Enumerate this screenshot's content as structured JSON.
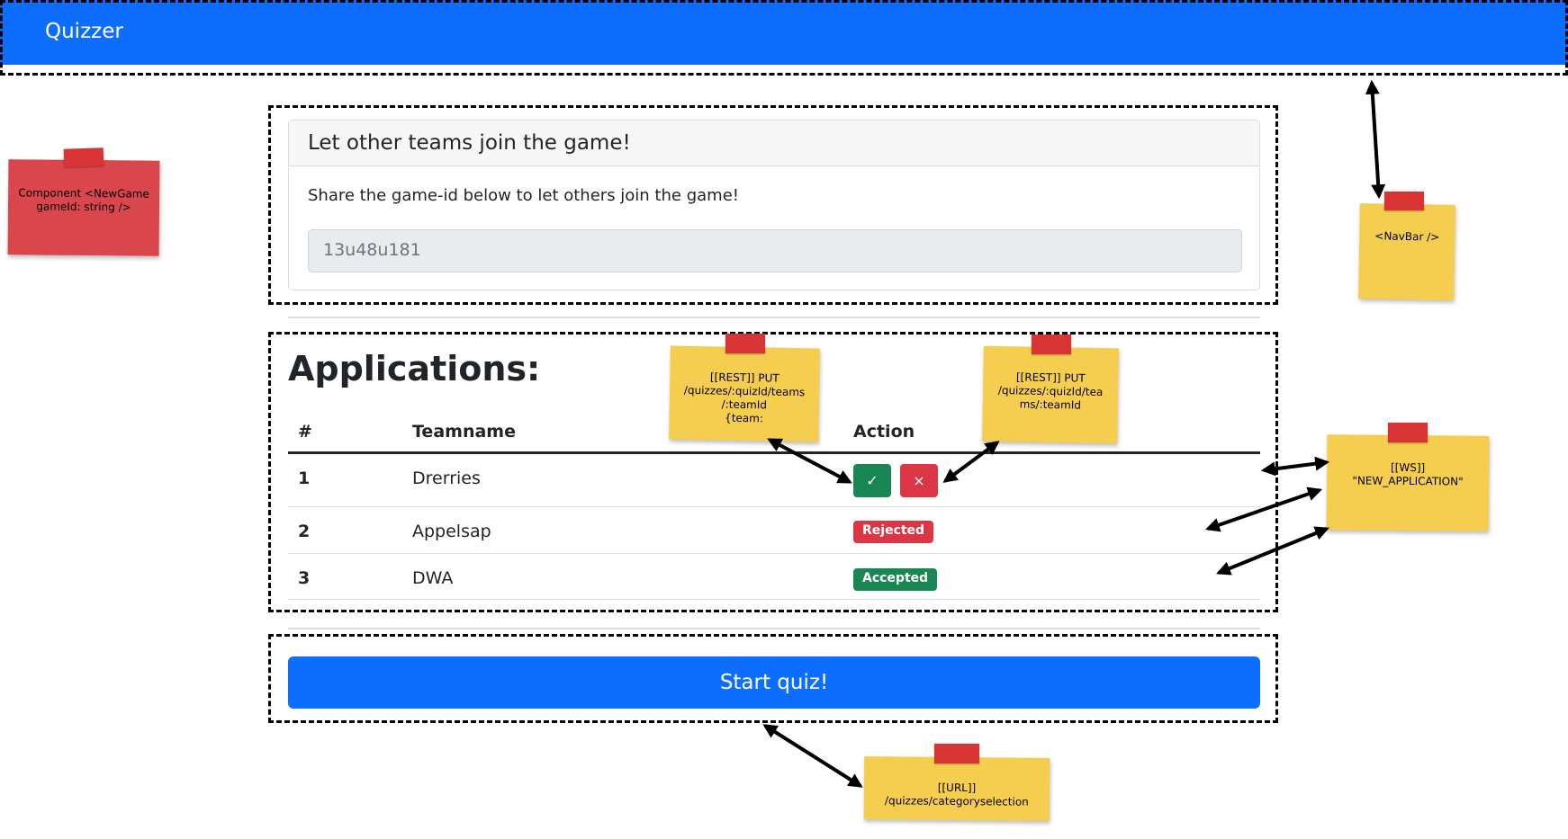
{
  "navbar": {
    "brand": "Quizzer"
  },
  "card": {
    "title": "Let other teams join the game!",
    "text": "Share the game-id below to let others join the game!",
    "game_id": "13u48u181"
  },
  "applications": {
    "title": "Applications:",
    "columns": [
      "#",
      "Teamname",
      "Action"
    ],
    "rows": [
      {
        "num": "1",
        "team": "Drerries",
        "accept_icon": "✓",
        "reject_icon": "×"
      },
      {
        "num": "2",
        "team": "Appelsap",
        "status": "Rejected"
      },
      {
        "num": "3",
        "team": "DWA",
        "status": "Accepted"
      }
    ]
  },
  "start_button": "Start quiz!",
  "notes": {
    "component": "Component <NewGame gameId: string />",
    "navbar": "<NavBar />",
    "rest_accept": "[[REST]] PUT\n/quizzes/:quizId/teams\n/:teamId\n{team:",
    "rest_reject": "[[REST]] PUT\n/quizzes/:quizId/tea\nms/:teamId",
    "ws": "[[WS]]\n\"NEW_APPLICATION\"",
    "url": "[[URL]]\n/quizzes/categoryselection"
  },
  "colors": {
    "primary": "#0d6efd",
    "success": "#198754",
    "danger": "#dc3545",
    "note_yellow": "#f5cd4f",
    "note_red": "#d9474d",
    "tape": "#d93434"
  }
}
